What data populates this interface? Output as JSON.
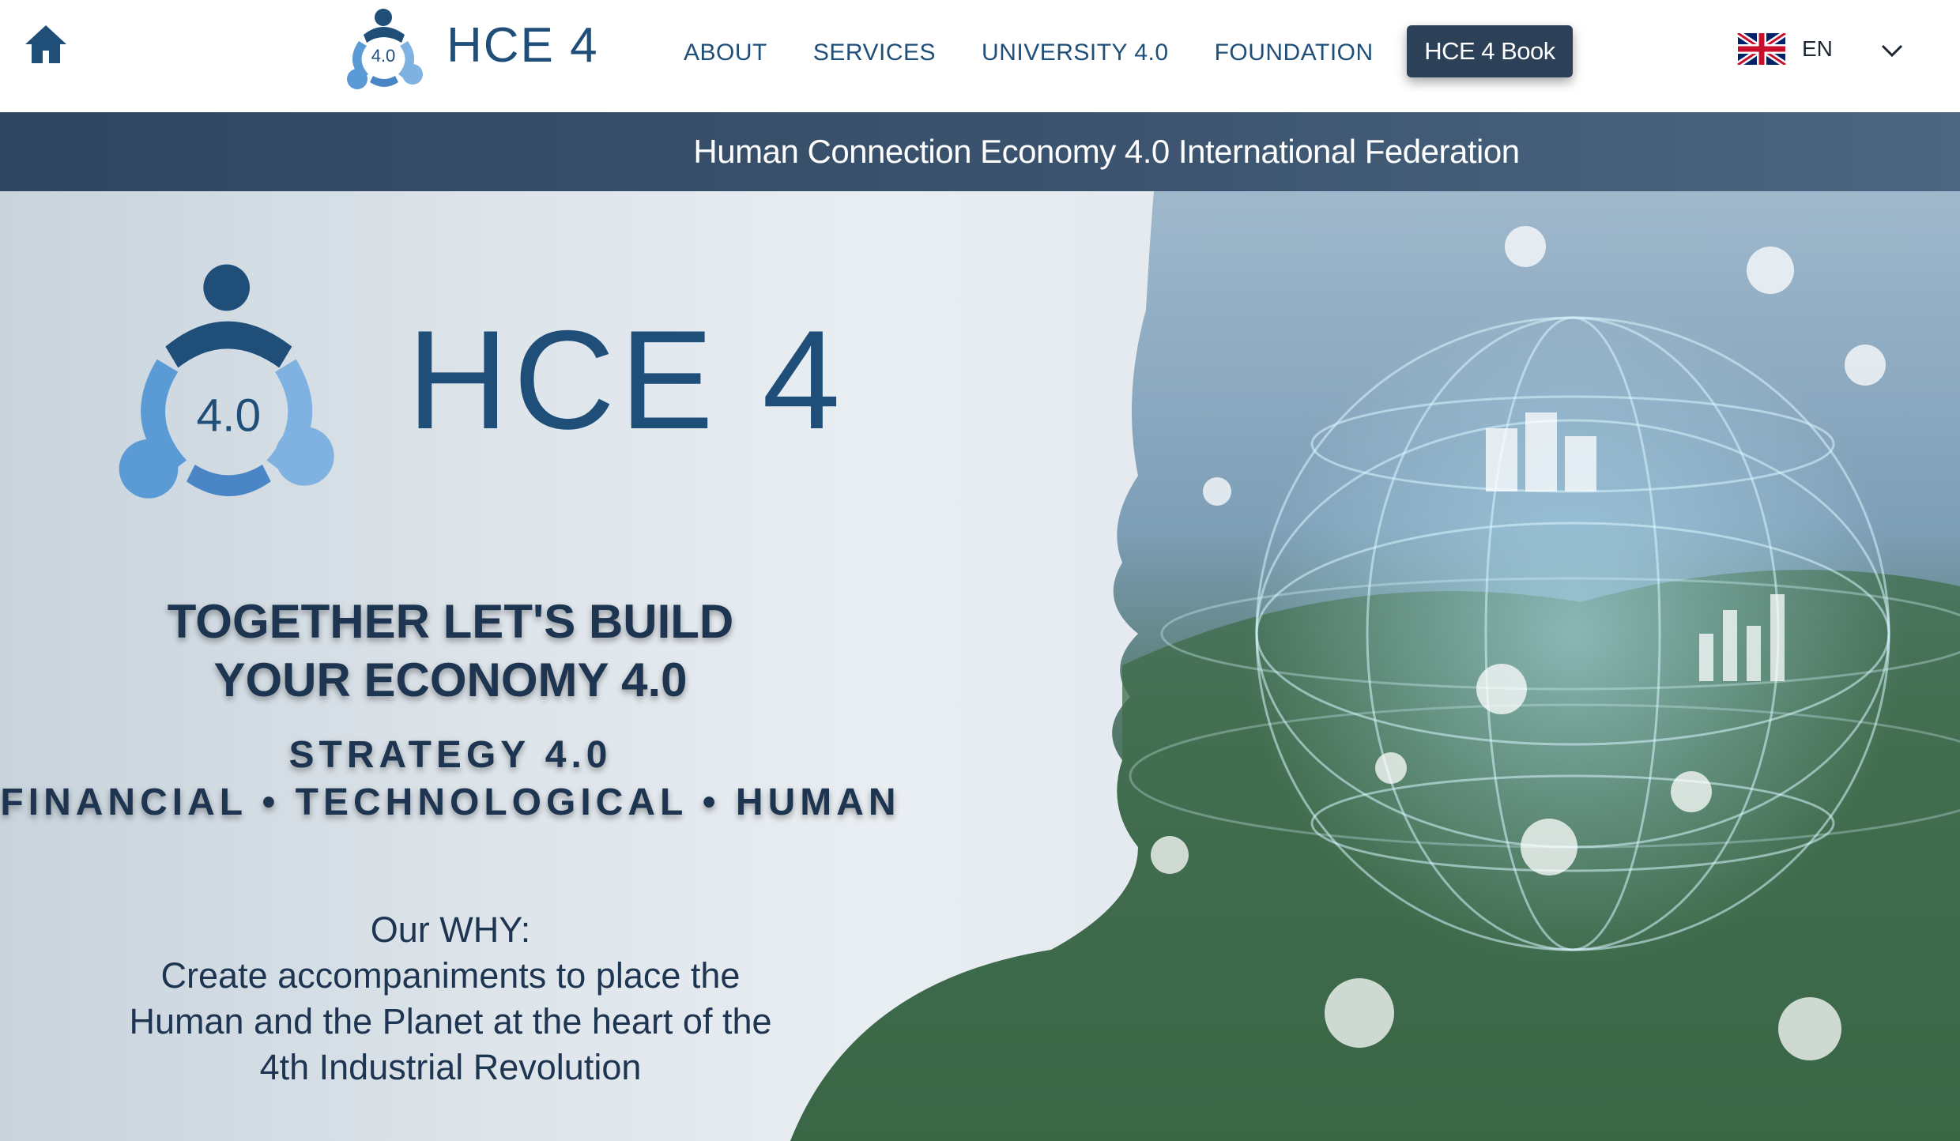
{
  "header": {
    "logo_text": "HCE 4",
    "logo_badge": "4.0",
    "nav": [
      {
        "label": "ABOUT"
      },
      {
        "label": "SERVICES"
      },
      {
        "label": "UNIVERSITY 4.0"
      },
      {
        "label": "FOUNDATION"
      }
    ],
    "book_button": "HCE 4 Book",
    "language": "EN",
    "icons": {
      "home": "home-icon",
      "flag": "uk-flag-icon",
      "dropdown": "chevron-down-icon"
    }
  },
  "banner": {
    "text": "Human Connection Economy 4.0 International Federation"
  },
  "hero": {
    "logo_text": "HCE 4",
    "logo_badge": "4.0",
    "tagline_line1": "TOGETHER LET'S BUILD",
    "tagline_line2": "YOUR ECONOMY 4.0",
    "strategy_line1": "STRATEGY 4.0",
    "strategy_line2": "FINANCIAL • TECHNOLOGICAL • HUMAN",
    "why_title": "Our WHY:",
    "why_line1": "Create accompaniments to place the",
    "why_line2": "Human and the Planet at the heart of the",
    "why_line3": "4th Industrial Revolution"
  },
  "colors": {
    "brand_dark": "#1f4e79",
    "brand_light": "#5b9bd5",
    "banner_bg": "#2f4660",
    "button_bg": "#2c4058"
  }
}
